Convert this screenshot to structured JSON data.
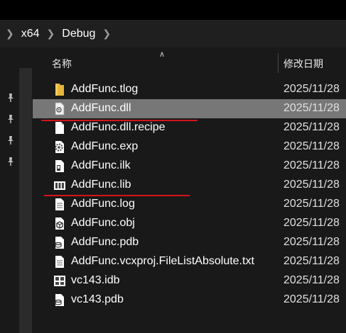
{
  "breadcrumb": {
    "items": [
      "x64",
      "Debug"
    ]
  },
  "list_header": {
    "name_label": "名称",
    "date_label": "修改日期"
  },
  "files": [
    {
      "name": "AddFunc.tlog",
      "date": "2025/11/28",
      "icon": "folder-icon"
    },
    {
      "name": "AddFunc.dll",
      "date": "2025/11/28",
      "icon": "dll-file-icon"
    },
    {
      "name": "AddFunc.dll.recipe",
      "date": "2025/11/28",
      "icon": "blank-file-icon"
    },
    {
      "name": "AddFunc.exp",
      "date": "2025/11/28",
      "icon": "exp-file-icon"
    },
    {
      "name": "AddFunc.ilk",
      "date": "2025/11/28",
      "icon": "ilk-file-icon"
    },
    {
      "name": "AddFunc.lib",
      "date": "2025/11/28",
      "icon": "lib-file-icon"
    },
    {
      "name": "AddFunc.log",
      "date": "2025/11/28",
      "icon": "text-file-icon"
    },
    {
      "name": "AddFunc.obj",
      "date": "2025/11/28",
      "icon": "obj-file-icon"
    },
    {
      "name": "AddFunc.pdb",
      "date": "2025/11/28",
      "icon": "pdb-file-icon"
    },
    {
      "name": "AddFunc.vcxproj.FileListAbsolute.txt",
      "date": "2025/11/28",
      "icon": "text-file-icon"
    },
    {
      "name": "vc143.idb",
      "date": "2025/11/28",
      "icon": "idb-file-icon"
    },
    {
      "name": "vc143.pdb",
      "date": "2025/11/28",
      "icon": "pdb-file-icon"
    }
  ],
  "selected_file": "AddFunc.dll",
  "highlight_color": "#d4141a",
  "selection_color": "#777777"
}
